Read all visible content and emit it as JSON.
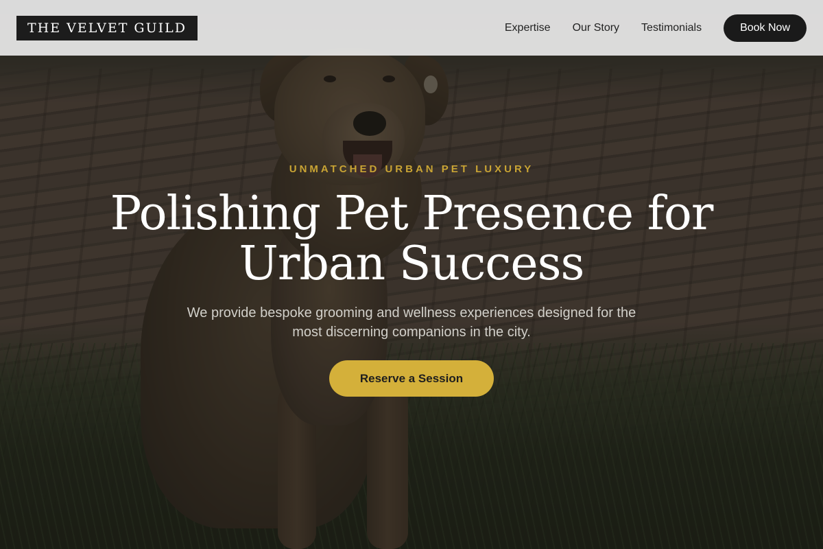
{
  "header": {
    "logo": "THE VELVET GUILD",
    "nav": [
      {
        "label": "Expertise"
      },
      {
        "label": "Our Story"
      },
      {
        "label": "Testimonials"
      }
    ],
    "cta_label": "Book Now"
  },
  "hero": {
    "eyebrow": "UNMATCHED URBAN PET LUXURY",
    "headline": "Polishing Pet Presence for Urban Success",
    "subtext": "We provide bespoke grooming and wellness experiences designed for the most discerning companions in the city.",
    "cta_label": "Reserve a Session",
    "background_image": "dog-sitting-on-brick-path-photo"
  },
  "colors": {
    "accent_gold": "#d4b03a",
    "eyebrow_gold": "#c9a434",
    "dark": "#1a1a1a",
    "header_bg": "#eeeeee"
  }
}
